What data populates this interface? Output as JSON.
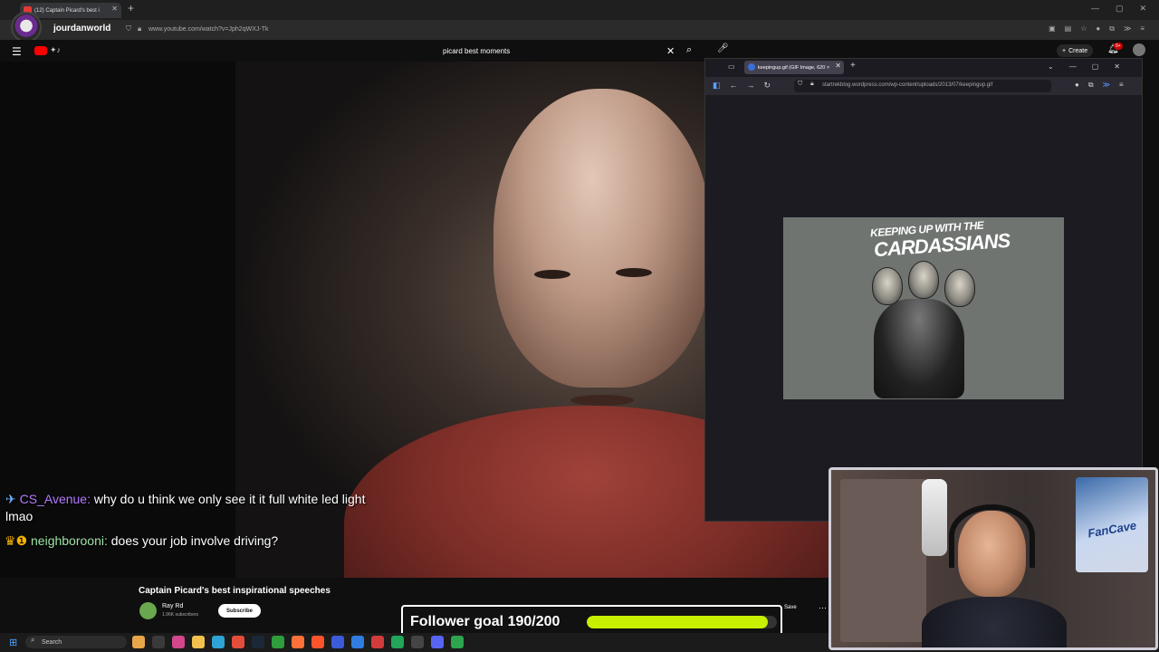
{
  "browser": {
    "tab_title": "(12) Captain Picard's best i",
    "url": "www.youtube.com/watch?v=Jph2qWXJ-Tk",
    "profile_label": "jourdanworld"
  },
  "youtube": {
    "search_value": "picard best moments",
    "create_label": "Create",
    "notif_count": "9+",
    "video_title": "Captain Picard's best inspirational speeches",
    "channel_name": "Ray Rd",
    "channel_subs": "1.96K subscribers",
    "subscribe_label": "Subscribe",
    "save_label": "Save"
  },
  "chat": [
    {
      "name": "CS_Avenue",
      "message": "why do u think we only see it it full white led light lmao"
    },
    {
      "name": "neighborooni",
      "message": "does your job involve driving?"
    }
  ],
  "follower_goal": {
    "text": "Follower goal 190/200",
    "fraction": 0.95
  },
  "firefox": {
    "tab_title": "keepingup.gif (GIF Image, 620 ×",
    "url": "startrekblog.wordpress.com/wp-content/uploads/2013/07/keepingup.gif",
    "gif_line1": "KEEPING UP WITH THE",
    "gif_line2": "CARDASSIANS"
  },
  "webcam": {
    "poster_text": "FanCave"
  },
  "taskbar": {
    "search_label": "Search"
  }
}
